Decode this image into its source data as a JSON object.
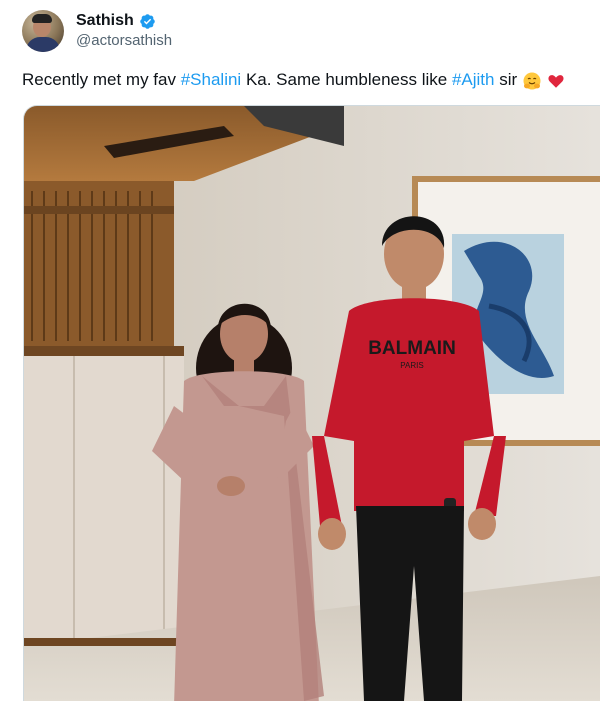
{
  "post": {
    "author": {
      "display_name": "Sathish",
      "handle": "@actorsathish",
      "verified_icon": "verified-badge-icon"
    },
    "text": {
      "part1": "Recently met my fav ",
      "hashtag1": "#Shalini",
      "part2": " Ka. Same humbleness like ",
      "hashtag2": "#Ajith",
      "part3": " sir",
      "emojis": [
        "hugging-face-emoji",
        "red-heart-emoji"
      ]
    },
    "photo": {
      "shirt_brand": "BALMAIN",
      "shirt_subtext": "PARIS"
    }
  },
  "colors": {
    "link": "#1d9bf0",
    "text": "#0f1419",
    "muted": "#536471",
    "verified": "#1d9bf0"
  }
}
